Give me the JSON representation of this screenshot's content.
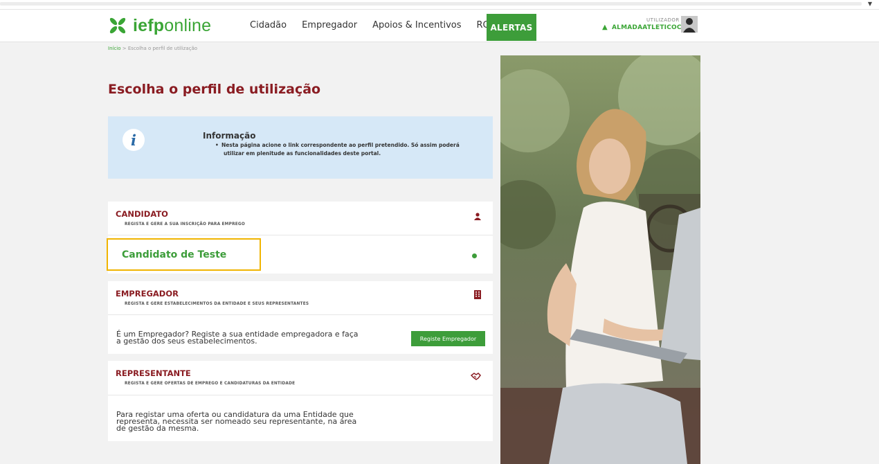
{
  "header": {
    "brand_bold": "iefp",
    "brand_light": "online",
    "nav": [
      "Cidadão",
      "Empregador",
      "Apoios & Incentivos",
      "RGPD"
    ],
    "alert_label": "ALERTAS",
    "user_label": "UTILIZADOR",
    "user_name": "ALMADAATLETICOC..."
  },
  "breadcrumb": {
    "home": "Início",
    "sep": ">",
    "current": "Escolha o perfil de utilização"
  },
  "page_title": "Escolha o perfil de utilização",
  "info": {
    "icon": "info-icon",
    "title": "Informação",
    "line1": "Nesta página acione o link correspondente ao perfil pretendido. Só assim poderá",
    "line2": "utilizar em plenitude as funcionalidades deste portal."
  },
  "candidato": {
    "title": "CANDIDATO",
    "subtitle": "REGISTA E GERE A SUA INSCRIÇÃO PARA EMPREGO",
    "link": "Candidato de Teste",
    "icon": "user-icon"
  },
  "empregador": {
    "title": "EMPREGADOR",
    "subtitle": "REGISTA E GERE ESTABELECIMENTOS DA ENTIDADE E SEUS REPRESENTANTES",
    "text_line1": "É um Empregador? Registe a sua entidade empregadora e faça",
    "text_line2": "a gestão dos seus estabelecimentos.",
    "button": "Registe Empregador",
    "icon": "building-icon"
  },
  "representante": {
    "title": "REPRESENTANTE",
    "subtitle": "REGISTA E GERE OFERTAS DE EMPREGO E CANDIDATURAS DA ENTIDADE",
    "text_line1": "Para registar uma oferta ou candidatura da uma Entidade que",
    "text_line2": "representa, necessita ser nomeado seu representante, na área",
    "text_line3": "de gestão da mesma.",
    "icon": "handshake-icon"
  },
  "colors": {
    "brand_green": "#3aa535",
    "title_red": "#8a1c22",
    "info_bg": "#d6e8f7",
    "highlight": "#f0b400"
  }
}
